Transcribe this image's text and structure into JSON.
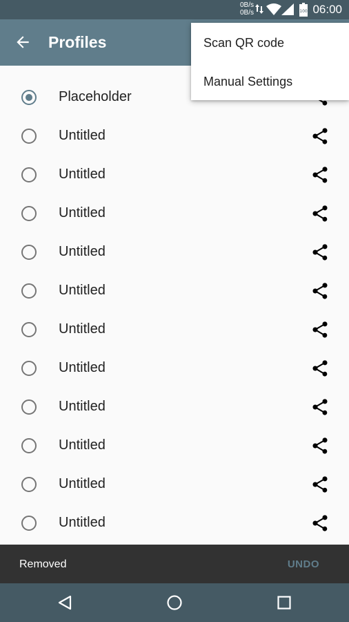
{
  "status_bar": {
    "upload_speed": "0B/s",
    "download_speed": "0B/s",
    "battery_level": "100",
    "time": "06:00",
    "icons": [
      "data-activity-icon",
      "wifi-icon",
      "cell-signal-icon",
      "battery-icon"
    ]
  },
  "app_bar": {
    "title": "Profiles",
    "back_icon": "arrow-back-icon"
  },
  "profiles": [
    {
      "name": "Placeholder",
      "selected": true
    },
    {
      "name": "Untitled",
      "selected": false
    },
    {
      "name": "Untitled",
      "selected": false
    },
    {
      "name": "Untitled",
      "selected": false
    },
    {
      "name": "Untitled",
      "selected": false
    },
    {
      "name": "Untitled",
      "selected": false
    },
    {
      "name": "Untitled",
      "selected": false
    },
    {
      "name": "Untitled",
      "selected": false
    },
    {
      "name": "Untitled",
      "selected": false
    },
    {
      "name": "Untitled",
      "selected": false
    },
    {
      "name": "Untitled",
      "selected": false
    },
    {
      "name": "Untitled",
      "selected": false
    }
  ],
  "share_icon": "share-icon",
  "menu": {
    "items": [
      {
        "label": "Scan QR code"
      },
      {
        "label": "Manual Settings"
      }
    ]
  },
  "snackbar": {
    "message": "Removed",
    "action": "UNDO"
  },
  "nav_bar": {
    "icons": [
      "back-triangle-icon",
      "home-circle-icon",
      "recents-square-icon"
    ]
  },
  "colors": {
    "status_bar": "#455a64",
    "app_bar": "#607d8b",
    "accent": "#607d8b",
    "snackbar": "#323232",
    "nav_bar": "#455a64"
  }
}
